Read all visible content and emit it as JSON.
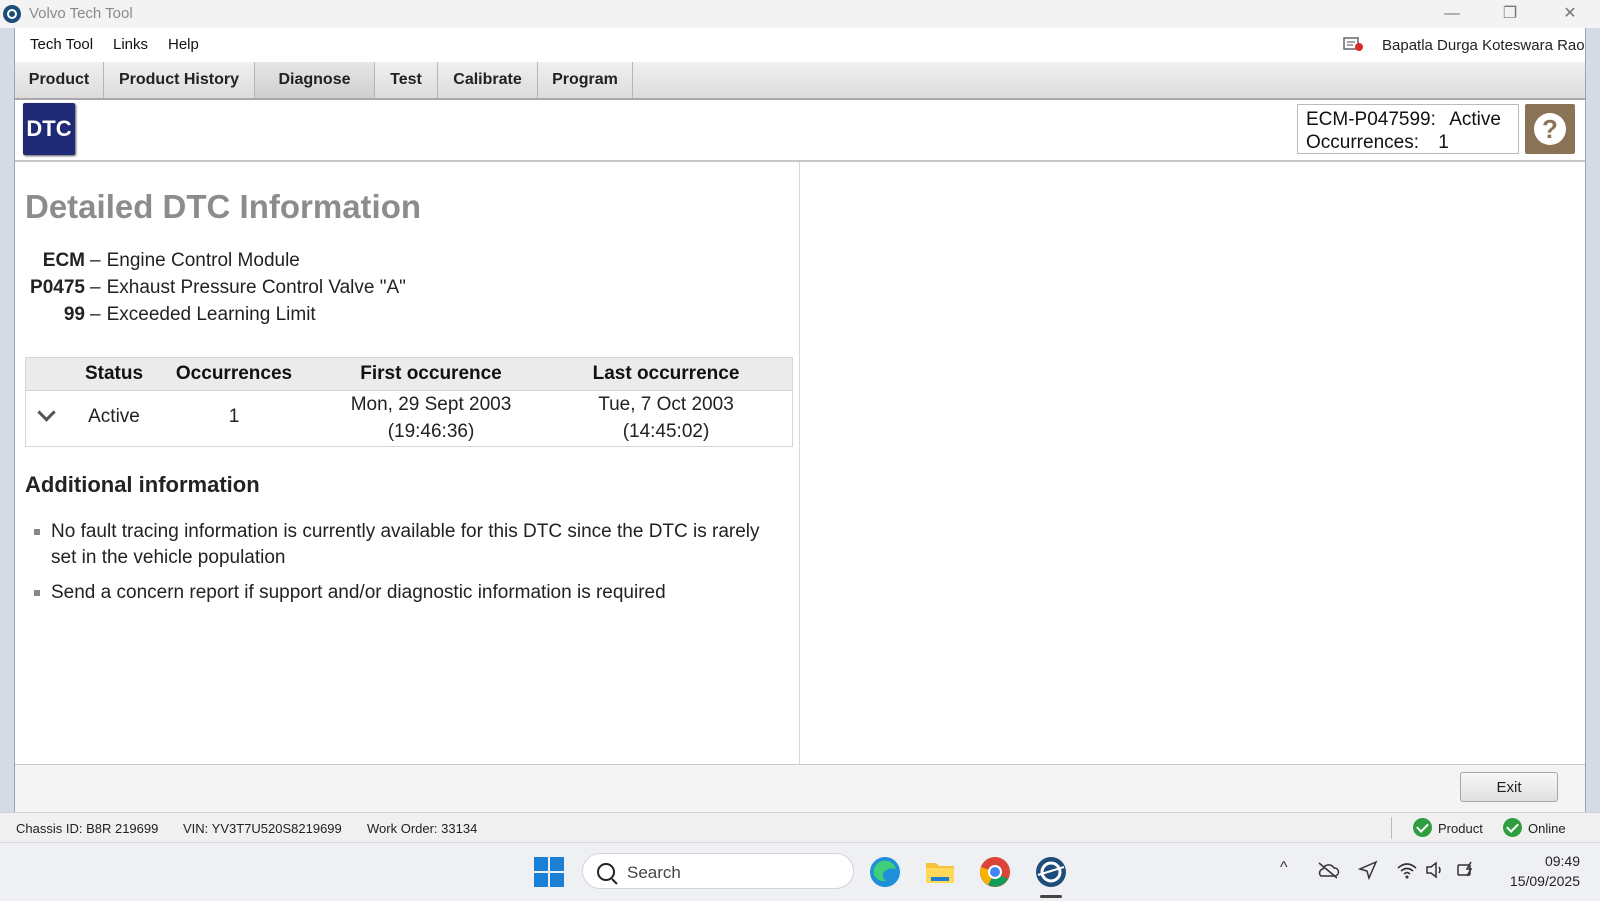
{
  "window": {
    "title": "Volvo Tech Tool",
    "minimize": "—",
    "restore": "❐",
    "close": "✕"
  },
  "menu": {
    "items": [
      "Tech Tool",
      "Links",
      "Help"
    ],
    "user_name": "Bapatla Durga Koteswara Rao"
  },
  "tabs": [
    {
      "label": "Product"
    },
    {
      "label": "Product History"
    },
    {
      "label": "Diagnose"
    },
    {
      "label": "Test"
    },
    {
      "label": "Calibrate"
    },
    {
      "label": "Program"
    }
  ],
  "header": {
    "badge": "DTC",
    "ecm_code": "ECM-P047599:",
    "ecm_status": "Active",
    "occurrences_label": "Occurrences:",
    "occurrences_value": "1",
    "help_symbol": "?"
  },
  "details": {
    "title": "Detailed DTC Information",
    "codes": [
      {
        "code": "ECM",
        "desc": "Engine Control Module"
      },
      {
        "code": "P0475",
        "desc": "Exhaust Pressure Control Valve \"A\""
      },
      {
        "code": "99",
        "desc": "Exceeded Learning Limit"
      }
    ],
    "dash": "–",
    "table": {
      "headers": [
        "Status",
        "Occurrences",
        "First occurence",
        "Last occurrence"
      ],
      "row": {
        "status": "Active",
        "occurrences": "1",
        "first_date": "Mon, 29 Sept 2003",
        "first_time": "(19:46:36)",
        "last_date": "Tue, 7 Oct 2003",
        "last_time": "(14:45:02)"
      }
    },
    "additional_title": "Additional information",
    "bullets": [
      "No fault tracing information is currently available for this DTC since the DTC is rarely set in the vehicle population",
      "Send a concern report if support and/or diagnostic information is required"
    ]
  },
  "buttons": {
    "exit": "Exit"
  },
  "status": {
    "chassis": "Chassis ID: B8R 219699",
    "vin": "VIN: YV3T7U520S8219699",
    "work_order": "Work Order: 33134",
    "product": "Product",
    "online": "Online"
  },
  "taskbar": {
    "search_placeholder": "Search",
    "time": "09:49",
    "date": "15/09/2025"
  },
  "colors": {
    "dtc_badge": "#1f2a77",
    "help_button": "#8a7257",
    "status_ok": "#2e9e3e",
    "title_gray": "#8c8c8c"
  }
}
